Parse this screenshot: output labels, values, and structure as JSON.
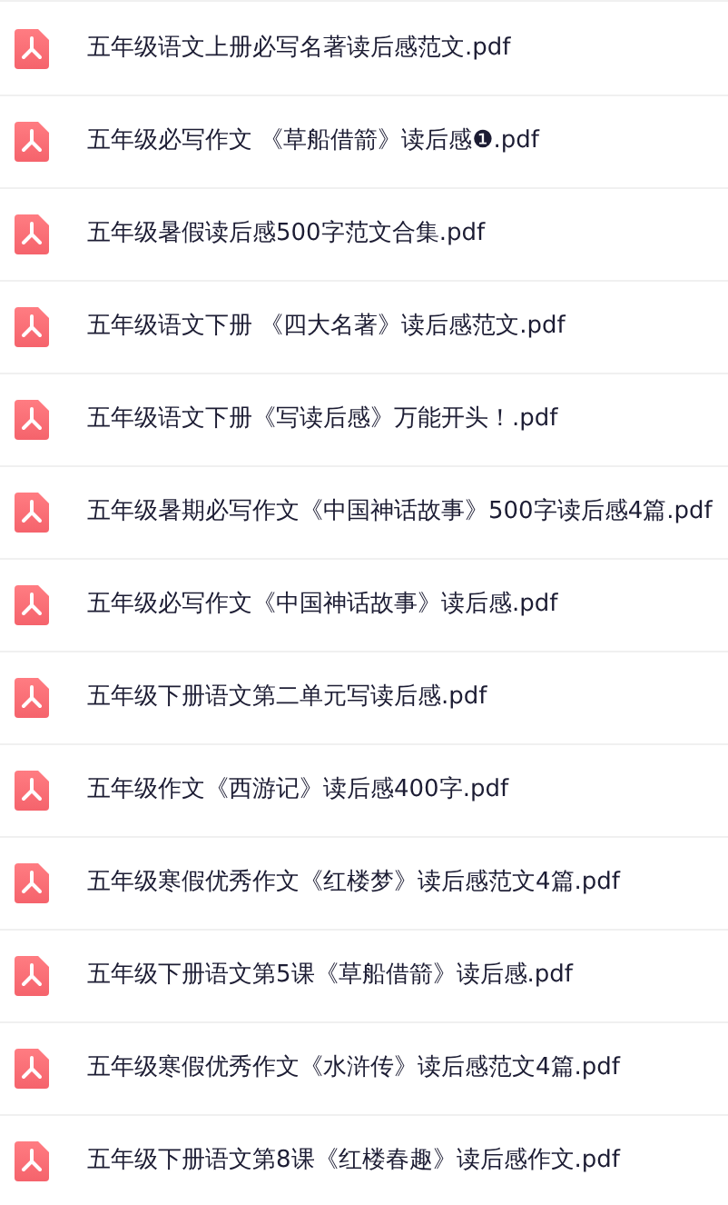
{
  "files": [
    {
      "name": "五年级语文上册必写名著读后感范文.pdf"
    },
    {
      "name": "五年级必写作文 《草船借箭》读后感❶.pdf"
    },
    {
      "name": "五年级暑假读后感500字范文合集.pdf"
    },
    {
      "name": "五年级语文下册 《四大名著》读后感范文.pdf"
    },
    {
      "name": "五年级语文下册《写读后感》万能开头！.pdf"
    },
    {
      "name": "五年级暑期必写作文《中国神话故事》500字读后感4篇.pdf"
    },
    {
      "name": "五年级必写作文《中国神话故事》读后感.pdf"
    },
    {
      "name": "五年级下册语文第二单元写读后感.pdf"
    },
    {
      "name": "五年级作文《西游记》读后感400字.pdf"
    },
    {
      "name": "五年级寒假优秀作文《红楼梦》读后感范文4篇.pdf"
    },
    {
      "name": "五年级下册语文第5课《草船借箭》读后感.pdf"
    },
    {
      "name": "五年级寒假优秀作文《水浒传》读后感范文4篇.pdf"
    },
    {
      "name": "五年级下册语文第8课《红楼春趣》读后感作文.pdf"
    }
  ]
}
